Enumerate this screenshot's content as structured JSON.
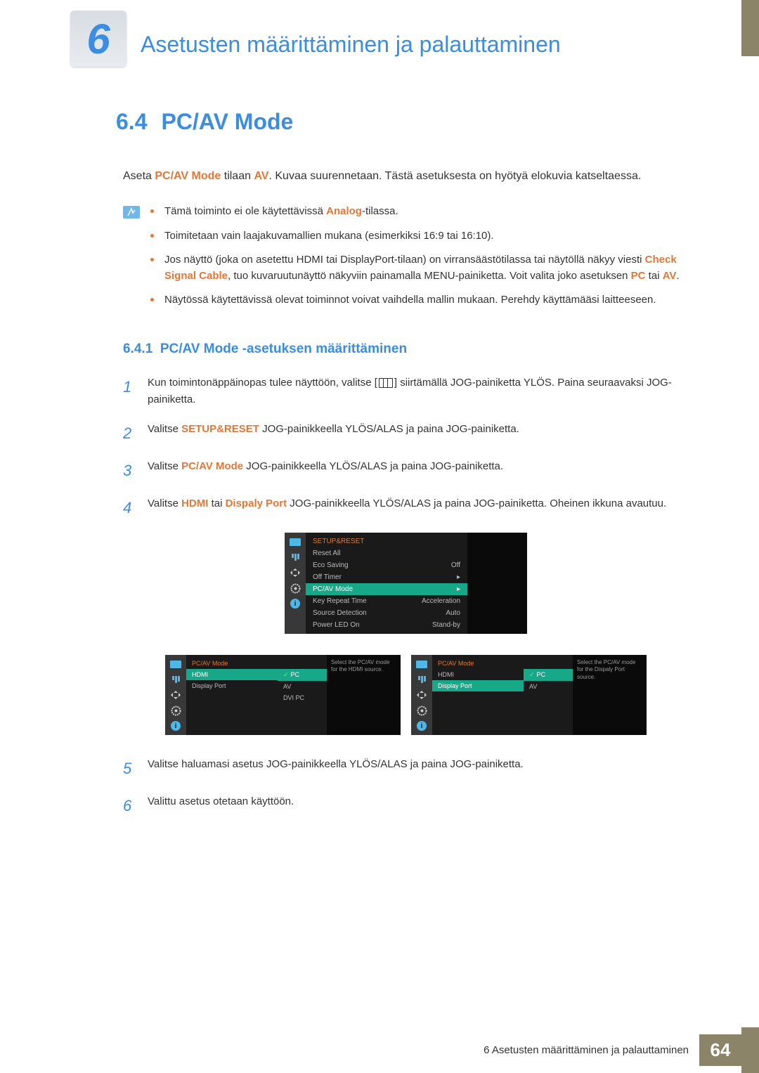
{
  "chapter": {
    "number": "6",
    "title": "Asetusten määrittäminen ja palauttaminen"
  },
  "section": {
    "number": "6.4",
    "title": "PC/AV Mode"
  },
  "intro": {
    "pre": "Aseta ",
    "hl1": "PC/AV Mode",
    "mid1": " tilaan ",
    "hl2": "AV",
    "post": ". Kuvaa suurennetaan. Tästä asetuksesta on hyötyä elokuvia katseltaessa."
  },
  "notes": {
    "b1": {
      "pre": "Tämä toiminto ei ole käytettävissä ",
      "hl": "Analog",
      "post": "-tilassa."
    },
    "b2": "Toimitetaan vain laajakuvamallien mukana (esimerkiksi 16:9 tai 16:10).",
    "b3": {
      "pre": "Jos näyttö (joka on asetettu HDMI tai DisplayPort-tilaan) on virransäästötilassa tai näytöllä näkyy viesti ",
      "hl1": "Check Signal Cable",
      "mid": ", tuo kuvaruutunäyttö näkyviin painamalla MENU-painiketta. Voit valita joko asetuksen ",
      "hl2": "PC",
      "mid2": " tai ",
      "hl3": "AV",
      "post": "."
    },
    "b4": "Näytössä käytettävissä olevat toiminnot voivat vaihdella mallin mukaan. Perehdy käyttämääsi laitteeseen."
  },
  "subsection": {
    "number": "6.4.1",
    "title": "PC/AV Mode -asetuksen määrittäminen"
  },
  "steps": {
    "s1": {
      "n": "1",
      "pre": "Kun toimintonäppäinopas tulee näyttöön, valitse [",
      "post": "] siirtämällä JOG-painiketta YLÖS. Paina seuraavaksi JOG-painiketta."
    },
    "s2": {
      "n": "2",
      "pre": "Valitse ",
      "hl": "SETUP&RESET",
      "post": " JOG-painikkeella YLÖS/ALAS ja paina JOG-painiketta."
    },
    "s3": {
      "n": "3",
      "pre": "Valitse ",
      "hl": "PC/AV Mode",
      "post": " JOG-painikkeella YLÖS/ALAS ja paina JOG-painiketta."
    },
    "s4": {
      "n": "4",
      "pre": "Valitse ",
      "hl1": "HDMI",
      "mid": " tai ",
      "hl2": "Dispaly Port",
      "post": " JOG-painikkeella YLÖS/ALAS ja paina JOG-painiketta. Oheinen ikkuna avautuu."
    },
    "s5": {
      "n": "5",
      "text": "Valitse haluamasi asetus JOG-painikkeella YLÖS/ALAS ja paina JOG-painiketta."
    },
    "s6": {
      "n": "6",
      "text": "Valittu asetus otetaan käyttöön."
    }
  },
  "osd1": {
    "title": "SETUP&RESET",
    "rows": [
      {
        "label": "Reset All",
        "value": ""
      },
      {
        "label": "Eco Saving",
        "value": "Off"
      },
      {
        "label": "Off Timer",
        "value": "▸"
      },
      {
        "label": "PC/AV Mode",
        "value": "▸",
        "sel": true
      },
      {
        "label": "Key Repeat Time",
        "value": "Acceleration"
      },
      {
        "label": "Source Detection",
        "value": "Auto"
      },
      {
        "label": "Power LED On",
        "value": "Stand-by"
      }
    ]
  },
  "osd2a": {
    "title": "PC/AV Mode",
    "left": [
      {
        "label": "HDMI",
        "sel": true
      },
      {
        "label": "Display Port"
      }
    ],
    "right": [
      {
        "label": "PC",
        "check": true,
        "sel": true
      },
      {
        "label": "AV"
      },
      {
        "label": "DVI PC"
      }
    ],
    "hint": "Select the PC/AV mode for the HDMI source."
  },
  "osd2b": {
    "title": "PC/AV Mode",
    "left": [
      {
        "label": "HDMI"
      },
      {
        "label": "Display Port",
        "sel": true
      }
    ],
    "right": [
      {
        "label": "PC",
        "check": true,
        "sel": true
      },
      {
        "label": "AV"
      }
    ],
    "hint": "Select the PC/AV mode for the Dispaly Port source."
  },
  "footer": {
    "text": "6 Asetusten määrittäminen ja palauttaminen",
    "page": "64"
  }
}
